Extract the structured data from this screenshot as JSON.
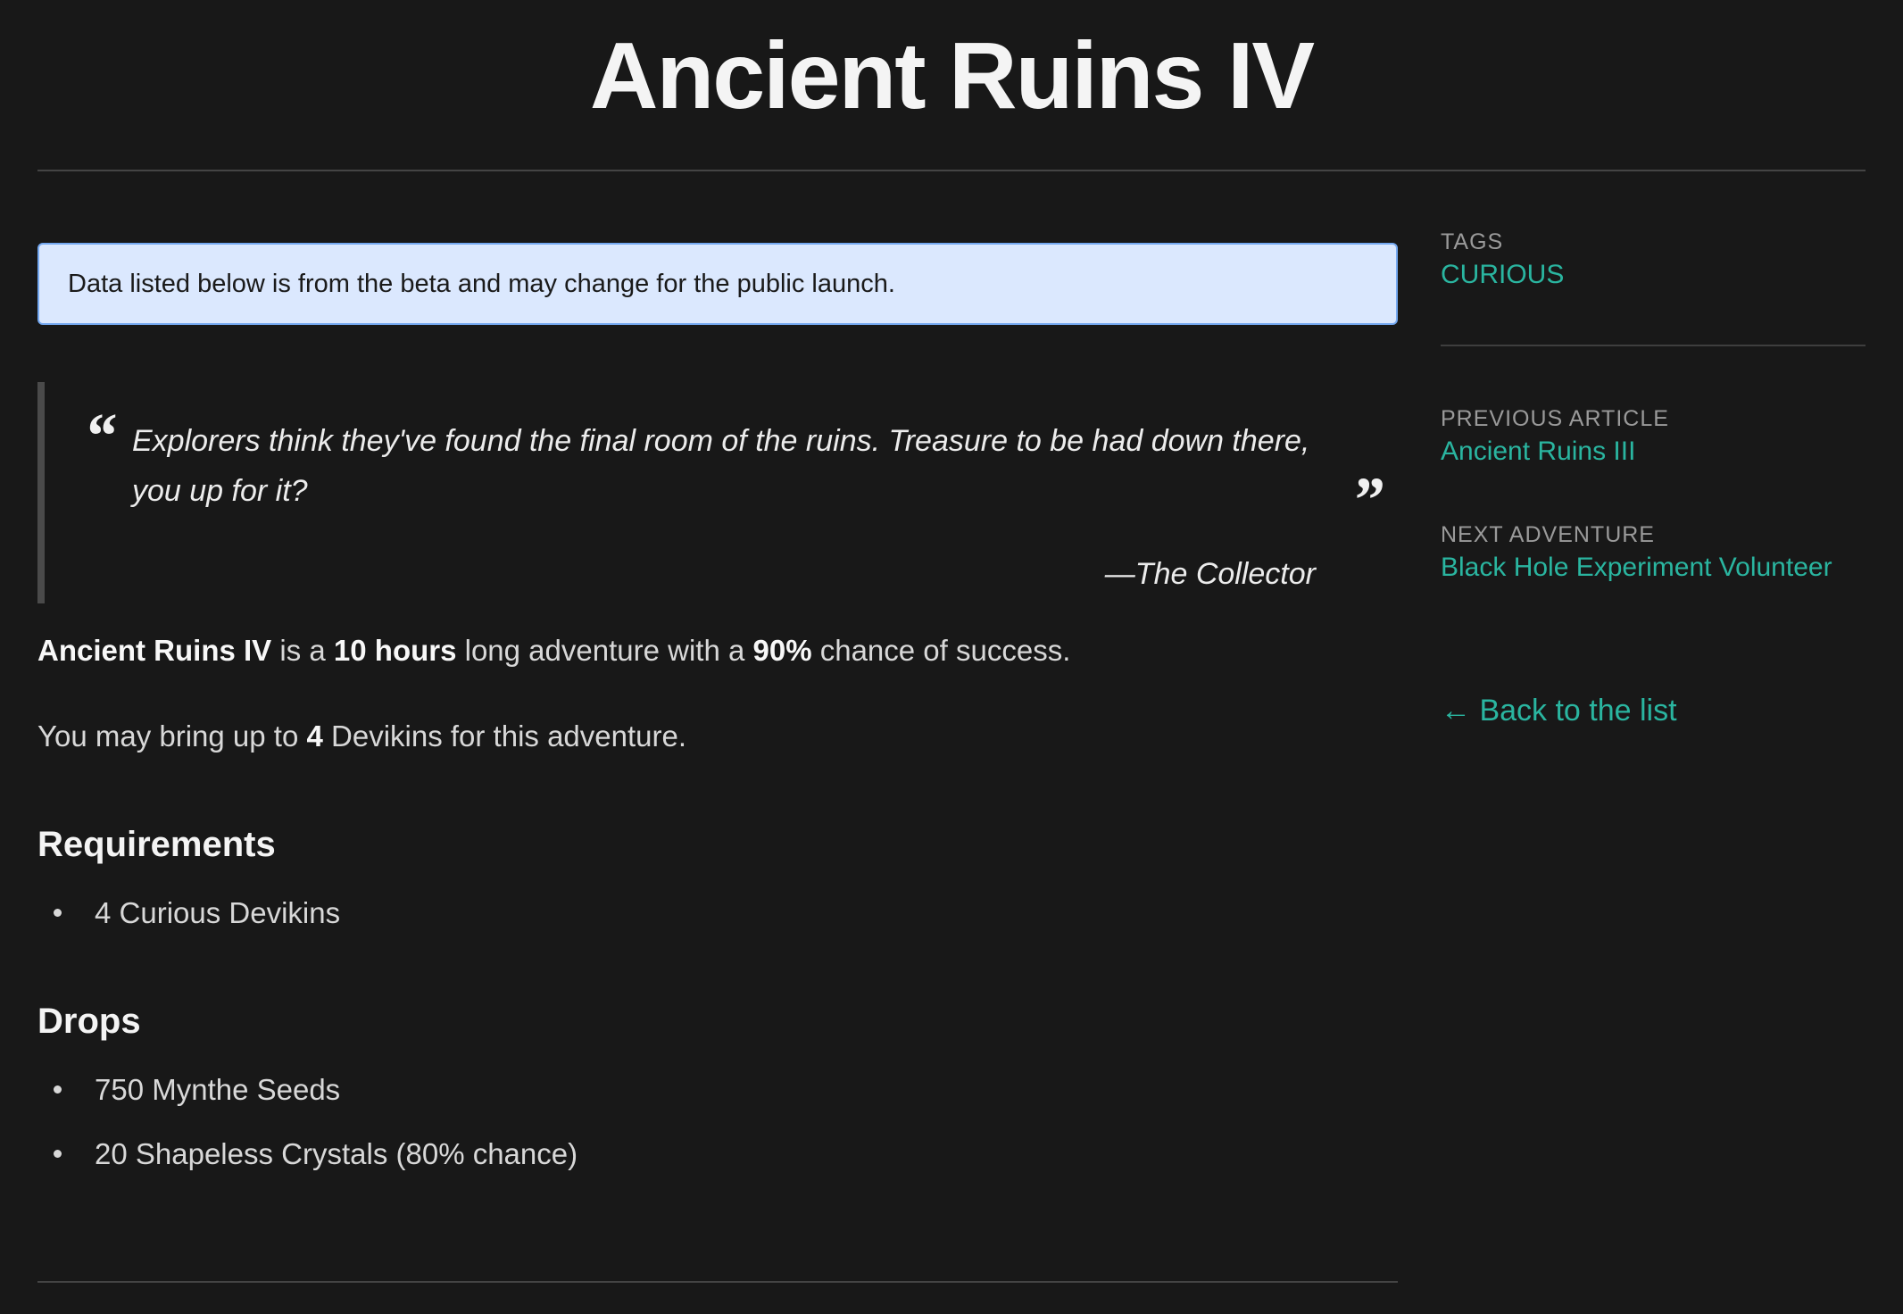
{
  "page": {
    "title": "Ancient Ruins IV"
  },
  "notice": {
    "text": "Data listed below is from the beta and may change for the public launch."
  },
  "quote": {
    "open_mark": "“",
    "close_mark": "”",
    "text": "Explorers think they've found the final room of the ruins. Treasure to be had down there, you up for it?",
    "author": "—The Collector"
  },
  "summary": {
    "name": "Ancient Ruins IV",
    "part_1": " is a ",
    "duration": "10 hours",
    "part_2": " long adventure with a ",
    "chance": "90%",
    "part_3": " chance of success."
  },
  "devikins": {
    "part_1": "You may bring up to ",
    "count": "4",
    "part_2": " Devikins for this adventure."
  },
  "requirements": {
    "heading": "Requirements",
    "items": [
      "4 Curious Devikins"
    ]
  },
  "drops": {
    "heading": "Drops",
    "items": [
      "750 Mynthe Seeds",
      "20 Shapeless Crystals (80% chance)"
    ]
  },
  "sidebar": {
    "tags_label": "TAGS",
    "tag": "CURIOUS",
    "previous_label": "PREVIOUS ARTICLE",
    "previous_link": "Ancient Ruins III",
    "next_label": "NEXT ADVENTURE",
    "next_link": "Black Hole Experiment Volunteer",
    "back_link": "← Back to the list"
  },
  "colors": {
    "background": "#181818",
    "accent_link": "#2ab5a0",
    "notice_bg": "#dbe8fe",
    "notice_border": "#74a8f0"
  }
}
